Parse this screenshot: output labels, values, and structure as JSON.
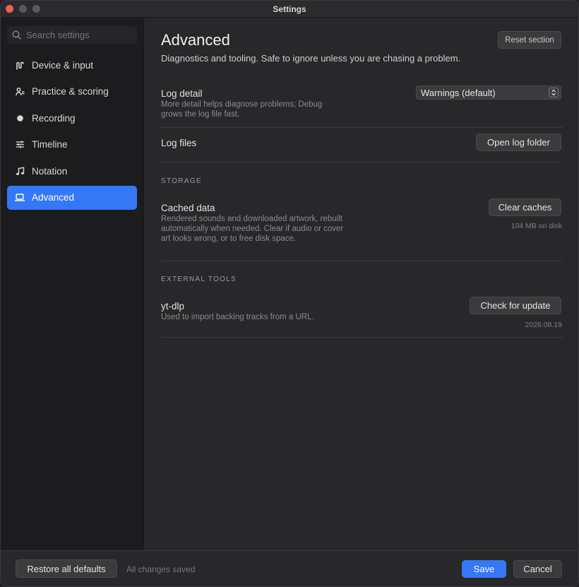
{
  "window": {
    "title": "Settings"
  },
  "sidebar": {
    "search_placeholder": "Search settings",
    "items": [
      {
        "label": "Device & input",
        "icon": "device-input-icon"
      },
      {
        "label": "Practice & scoring",
        "icon": "practice-icon"
      },
      {
        "label": "Recording",
        "icon": "record-dot-icon"
      },
      {
        "label": "Timeline",
        "icon": "sliders-icon"
      },
      {
        "label": "Notation",
        "icon": "music-note-icon"
      },
      {
        "label": "Advanced",
        "icon": "laptop-icon",
        "active": true
      }
    ]
  },
  "main": {
    "title": "Advanced",
    "subtitle": "Diagnostics and tooling. Safe to ignore unless you are chasing a problem.",
    "reset_label": "Reset section",
    "log_detail": {
      "label": "Log detail",
      "description": "More detail helps diagnose problems; Debug grows the log file fast.",
      "selected": "Warnings (default)"
    },
    "log_files": {
      "label": "Log files",
      "button": "Open log folder"
    },
    "storage": {
      "heading": "STORAGE",
      "cached_label": "Cached data",
      "cached_description": "Rendered sounds and downloaded artwork, rebuilt automatically when needed. Clear if audio or cover art looks wrong, or to free disk space.",
      "button": "Clear caches",
      "size": "104 MB on disk"
    },
    "external_tools": {
      "heading": "EXTERNAL TOOLS",
      "tool_label": "yt-dlp",
      "tool_description": "Used to import backing tracks from a URL.",
      "button": "Check for update",
      "version": "2026.08.19"
    }
  },
  "footer": {
    "restore_label": "Restore all defaults",
    "status": "All changes saved",
    "save_label": "Save",
    "cancel_label": "Cancel"
  },
  "colors": {
    "accent": "#3478f6",
    "close": "#ec5f57"
  }
}
